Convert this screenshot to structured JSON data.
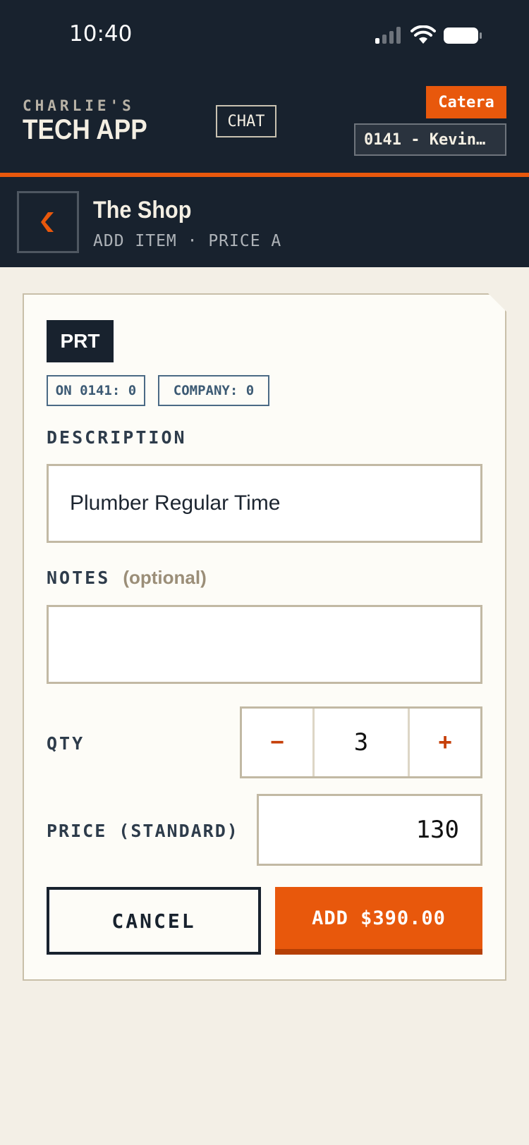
{
  "status_bar": {
    "time": "10:40"
  },
  "header": {
    "brand_small": "CHARLIE'S",
    "brand_big": "TECH APP",
    "chat_label": "CHAT",
    "company_badge": "Catera",
    "job_select_value": "0141 - Kevin…"
  },
  "subheader": {
    "title": "The Shop",
    "subtitle": "ADD ITEM · PRICE A"
  },
  "form": {
    "type_badge": "PRT",
    "chips": [
      "ON 0141: 0",
      "COMPANY: 0"
    ],
    "description_label": "DESCRIPTION",
    "description_value": "Plumber Regular Time",
    "notes_label": "NOTES",
    "notes_optional": "(optional)",
    "notes_value": "",
    "qty_label": "QTY",
    "qty_minus": "−",
    "qty_value": "3",
    "qty_plus": "+",
    "price_label": "PRICE (STANDARD)",
    "price_value": "130",
    "cancel_label": "CANCEL",
    "add_label": "ADD $390.00"
  },
  "colors": {
    "navy": "#18222e",
    "accent": "#e8580c",
    "background": "#f3efe6",
    "card": "#fdfcf7"
  },
  "icons": [
    "cellular-signal-icon",
    "wifi-icon",
    "battery-icon",
    "chevron-left-icon"
  ]
}
